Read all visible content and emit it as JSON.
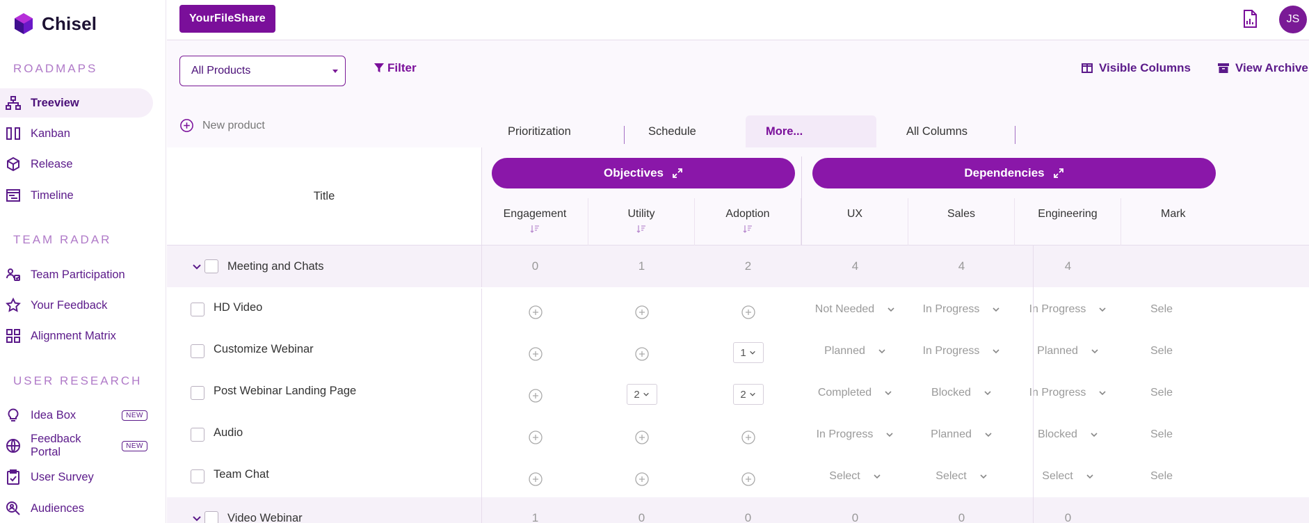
{
  "brand": {
    "name": "Chisel"
  },
  "sidebar": {
    "sections": [
      {
        "title": "ROADMAPS",
        "items": [
          {
            "label": "Treeview",
            "icon": "treeview-icon",
            "active": true
          },
          {
            "label": "Kanban",
            "icon": "kanban-icon"
          },
          {
            "label": "Release",
            "icon": "release-cube-icon"
          },
          {
            "label": "Timeline",
            "icon": "timeline-icon"
          }
        ]
      },
      {
        "title": "TEAM RADAR",
        "items": [
          {
            "label": "Team Participation",
            "icon": "team-participation-icon"
          },
          {
            "label": "Your Feedback",
            "icon": "star-icon"
          },
          {
            "label": "Alignment Matrix",
            "icon": "grid-icon"
          }
        ]
      },
      {
        "title": "USER RESEARCH",
        "items": [
          {
            "label": "Idea Box",
            "icon": "lightbulb-icon",
            "badge": "NEW"
          },
          {
            "label": "Feedback Portal",
            "icon": "globe-icon",
            "badge": "NEW"
          },
          {
            "label": "User Survey",
            "icon": "clipboard-icon"
          },
          {
            "label": "Audiences",
            "icon": "search-users-icon"
          }
        ]
      }
    ]
  },
  "topbar": {
    "project": "YourFileShare",
    "avatar_initials": "JS"
  },
  "toolbar": {
    "product_select": "All Products",
    "filter": "Filter",
    "visible_columns": "Visible Columns",
    "view_archive": "View Archive",
    "new_product": "New product",
    "tabs": [
      "Prioritization",
      "Schedule",
      "More...",
      "All Columns"
    ],
    "active_tab": "More..."
  },
  "grid": {
    "title_header": "Title",
    "groups": [
      "Objectives",
      "Dependencies"
    ],
    "columns": [
      "Engagement",
      "Utility",
      "Adoption",
      "UX",
      "Sales",
      "Engineering",
      "Mark"
    ],
    "rows": [
      {
        "type": "parent",
        "title": "Meeting and Chats",
        "values": [
          "0",
          "1",
          "2",
          "4",
          "4",
          "4",
          ""
        ]
      },
      {
        "type": "child",
        "title": "HD Video",
        "objectives": [
          "+",
          "+",
          "+"
        ],
        "deps": [
          "Not Needed",
          "In Progress",
          "In Progress",
          "Sele"
        ]
      },
      {
        "type": "child",
        "title": "Customize Webinar",
        "objectives": [
          "+",
          "+",
          "1"
        ],
        "deps": [
          "Planned",
          "In Progress",
          "Planned",
          "Sele"
        ]
      },
      {
        "type": "child",
        "title": "Post Webinar Landing Page",
        "objectives": [
          "+",
          "2",
          "2"
        ],
        "deps": [
          "Completed",
          "Blocked",
          "In Progress",
          "Sele"
        ]
      },
      {
        "type": "child",
        "title": "Audio",
        "objectives": [
          "+",
          "+",
          "+"
        ],
        "deps": [
          "In Progress",
          "Planned",
          "Blocked",
          "Sele"
        ]
      },
      {
        "type": "child",
        "title": "Team Chat",
        "objectives": [
          "+",
          "+",
          "+"
        ],
        "deps": [
          "Select",
          "Select",
          "Select",
          "Sele"
        ]
      },
      {
        "type": "parent",
        "title": "Video Webinar",
        "values": [
          "1",
          "0",
          "0",
          "0",
          "0",
          "0",
          ""
        ]
      }
    ]
  },
  "colors": {
    "primary": "#7a0f9a",
    "pill": "#8a17a9",
    "nav": "#5b1a8a",
    "section": "#b07ac8"
  }
}
